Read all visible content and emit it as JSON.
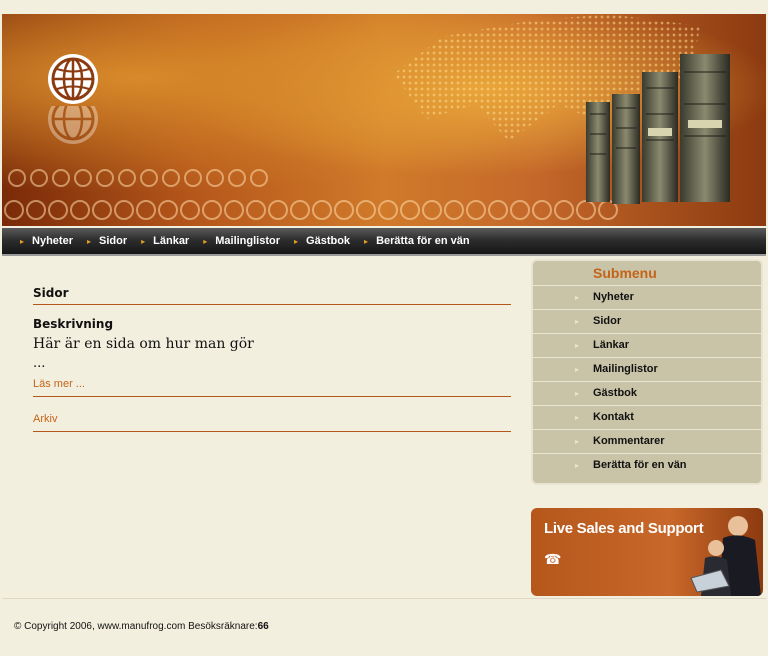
{
  "header": {
    "logo_icon": "globe-icon"
  },
  "nav": {
    "items": [
      {
        "label": "Nyheter"
      },
      {
        "label": "Sidor"
      },
      {
        "label": "Länkar"
      },
      {
        "label": "Mailinglistor"
      },
      {
        "label": "Gästbok"
      },
      {
        "label": "Berätta för en vän"
      }
    ]
  },
  "main": {
    "page_title": "Sidor",
    "section_title": "Beskrivning",
    "description": "Här är en sida om hur man gör",
    "ellipsis": "...",
    "read_more": "Läs mer ...",
    "archive": "Arkiv"
  },
  "submenu": {
    "title": "Submenu",
    "items": [
      {
        "label": "Nyheter"
      },
      {
        "label": "Sidor"
      },
      {
        "label": "Länkar"
      },
      {
        "label": "Mailinglistor"
      },
      {
        "label": "Gästbok"
      },
      {
        "label": "Kontakt"
      },
      {
        "label": "Kommentarer"
      },
      {
        "label": "Berätta för en vän"
      }
    ]
  },
  "support": {
    "title": "Live Sales and Support",
    "icon": "phone-icon"
  },
  "footer": {
    "copyright": "© Copyright 2006, www.manufrog.com Besöksräknare:",
    "counter": "66"
  },
  "colors": {
    "accent": "#c46418",
    "nav_bg": "#1f1f1f",
    "submenu_bg": "#c9c4a8",
    "page_bg": "#f3efdf"
  }
}
